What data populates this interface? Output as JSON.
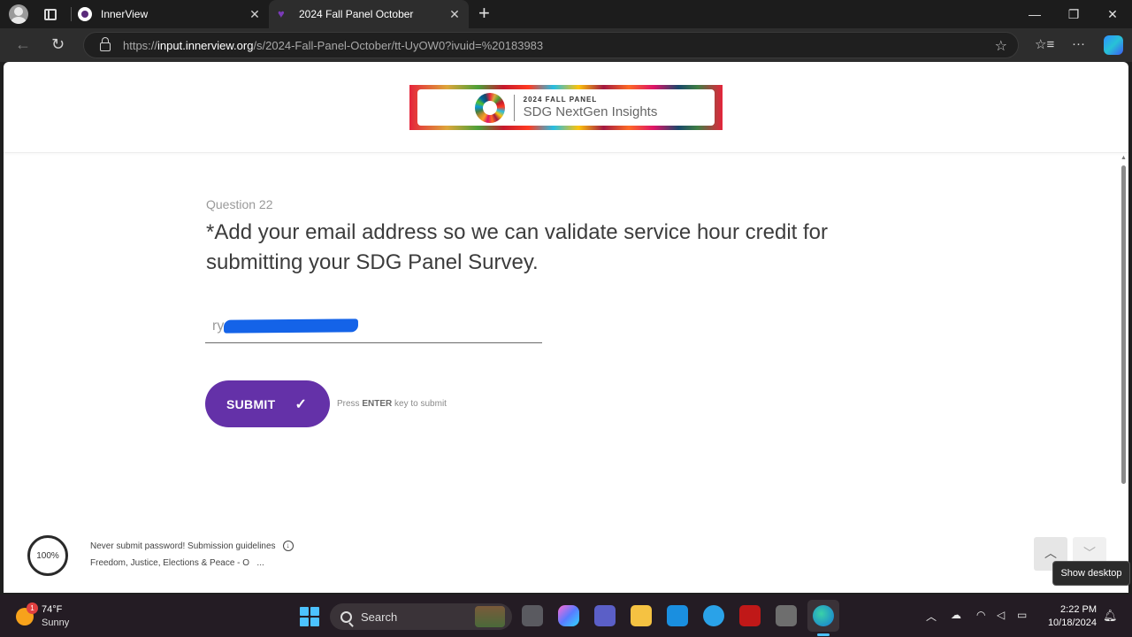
{
  "browser": {
    "tabs": [
      {
        "title": "InnerView"
      },
      {
        "title": "2024 Fall Panel October"
      }
    ],
    "url_prefix": "https://",
    "url_domain": "input.innerview.org",
    "url_path": "/s/2024-Fall-Panel-October/tt-UyOW0?ivuid=%20183983"
  },
  "banner": {
    "small": "2024 FALL PANEL",
    "big": "SDG NextGen Insights"
  },
  "question": {
    "number": "Question 22",
    "text": "*Add your email address so we can validate service hour credit for submitting your SDG Panel Survey.",
    "input_value": "ry"
  },
  "submit": {
    "label": "SUBMIT",
    "hint_prefix": "Press",
    "hint_key": "ENTER",
    "hint_suffix": "key to submit"
  },
  "footer": {
    "progress": "100%",
    "line1": "Never submit password! Submission guidelines",
    "line2": "Freedom, Justice, Elections & Peace - O",
    "more": "..."
  },
  "tooltip": "Show desktop",
  "taskbar": {
    "temp": "74°F",
    "condition": "Sunny",
    "weather_badge": "1",
    "search_label": "Search",
    "time": "2:22 PM",
    "date": "10/18/2024"
  },
  "colors": {
    "submit_bg": "#6431a8",
    "redaction": "#1463e8"
  }
}
